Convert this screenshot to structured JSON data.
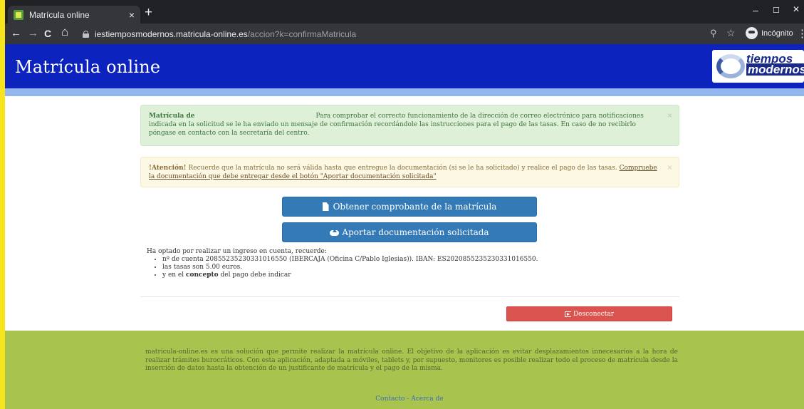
{
  "browser": {
    "tab_title": "Matrícula online",
    "tab_close": "×",
    "new_tab": "+",
    "url_host": "iestiemposmodernos.matricula-online.es",
    "url_path": "/accion?k=confirmaMatricula",
    "incognito_label": "Incógnito",
    "back": "←",
    "forward": "→",
    "reload": "C",
    "home": "⌂",
    "zoom": "⚲",
    "star": "☆",
    "menu": "⋮",
    "minimize": "–",
    "maximize": "☐",
    "close": "✕"
  },
  "header": {
    "title": "Matrícula online",
    "logo_line1": "tiempos",
    "logo_line2": "modernos"
  },
  "alerts": {
    "success": {
      "strong": "Matrícula de",
      "text": "Para comprobar el correcto funcionamiento de la dirección de correo electrónico para notificaciones indicada en la solicitud se le ha enviado un mensaje de confirmación recordándole las instrucciones para el pago de las tasas. En caso de no recibirlo póngase en contacto con la secretaría del centro.",
      "close": "×"
    },
    "warning": {
      "strong": "!Atención!",
      "text": "Recuerde que la matrícula no será válida hasta que entregue la documentación (si se le ha solicitado) y realice el pago de las tasas.",
      "link": "Compruebe la documentación que debe entregar desde el botón \"Aportar documentación solicitada\"",
      "close": "×"
    }
  },
  "buttons": {
    "receipt": "Obtener comprobante de la matrícula",
    "upload": "Aportar documentación solicitada",
    "logout": "Desconectar"
  },
  "payment": {
    "intro": "Ha optado por realizar un ingreso en cuenta, recuerde:",
    "account_prefix": "nº de cuenta 20855235230331016550 (IBERCAJA (Oficina C/Pablo Iglesias)). IBAN: ES2020855235230331016550.",
    "fees": "las tasas son 5.00 euros.",
    "concept_pre": "y en el ",
    "concept_bold": "concepto",
    "concept_post": " del pago debe indicar"
  },
  "footer": {
    "text": "matricula-online.es es una solución que permite realizar la matrícula online. El objetivo de la aplicación es evitar desplazamientos innecesarios a la hora de realizar trámites burocráticos. Con esta aplicación, adaptada a móviles, tablets y, por supuesto, monitores es posible realizar todo el proceso de matrícula desde la inserción de datos hasta la obtención de un justificante de matrícula y el pago de la misma.",
    "link_contact": "Contacto",
    "separator": " - ",
    "link_about": "Acerca de"
  },
  "colors": {
    "header_bg": "#0c24bd",
    "subheader_bg": "#93b6ef",
    "footer_bg": "#a8c34e",
    "primary": "#337ab7",
    "danger": "#d9534f"
  }
}
